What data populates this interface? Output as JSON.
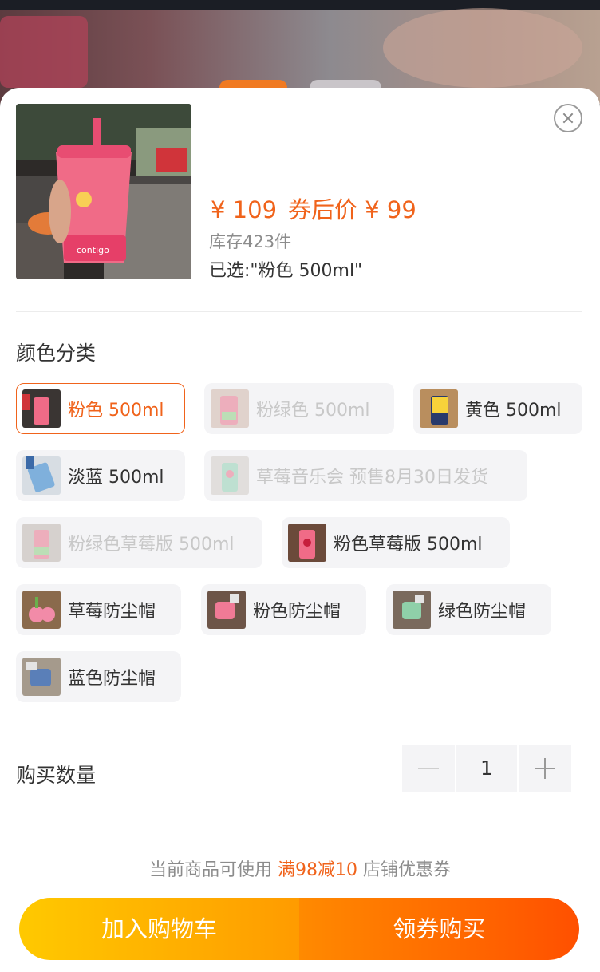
{
  "product": {
    "price": "¥ 109",
    "coupon_price": "券后价 ¥ 99",
    "stock": "库存423件",
    "selected": "已选:\"粉色 500ml\""
  },
  "color_section": {
    "title": "颜色分类",
    "options": [
      {
        "label": "粉色 500ml",
        "state": "selected"
      },
      {
        "label": "粉绿色 500ml",
        "state": "disabled"
      },
      {
        "label": "黄色 500ml",
        "state": "normal"
      },
      {
        "label": "淡蓝 500ml",
        "state": "normal"
      },
      {
        "label": "草莓音乐会 预售8月30日发货",
        "state": "disabled"
      },
      {
        "label": "粉绿色草莓版 500ml",
        "state": "disabled"
      },
      {
        "label": "粉色草莓版 500ml",
        "state": "normal"
      },
      {
        "label": "草莓防尘帽",
        "state": "normal"
      },
      {
        "label": "粉色防尘帽",
        "state": "normal"
      },
      {
        "label": "绿色防尘帽",
        "state": "normal"
      },
      {
        "label": "蓝色防尘帽",
        "state": "normal"
      }
    ]
  },
  "quantity": {
    "label": "购买数量",
    "value": "1"
  },
  "coupon": {
    "prefix": "当前商品可使用",
    "highlight": "满98减10",
    "suffix": "店铺优惠券"
  },
  "actions": {
    "add_to_cart": "加入购物车",
    "get_coupon_buy": "领券购买"
  },
  "colors": {
    "accent": "#f0631b",
    "cart_gradient": [
      "#ffc900",
      "#ff9b00"
    ],
    "buy_gradient": [
      "#ff8a00",
      "#ff5000"
    ]
  }
}
